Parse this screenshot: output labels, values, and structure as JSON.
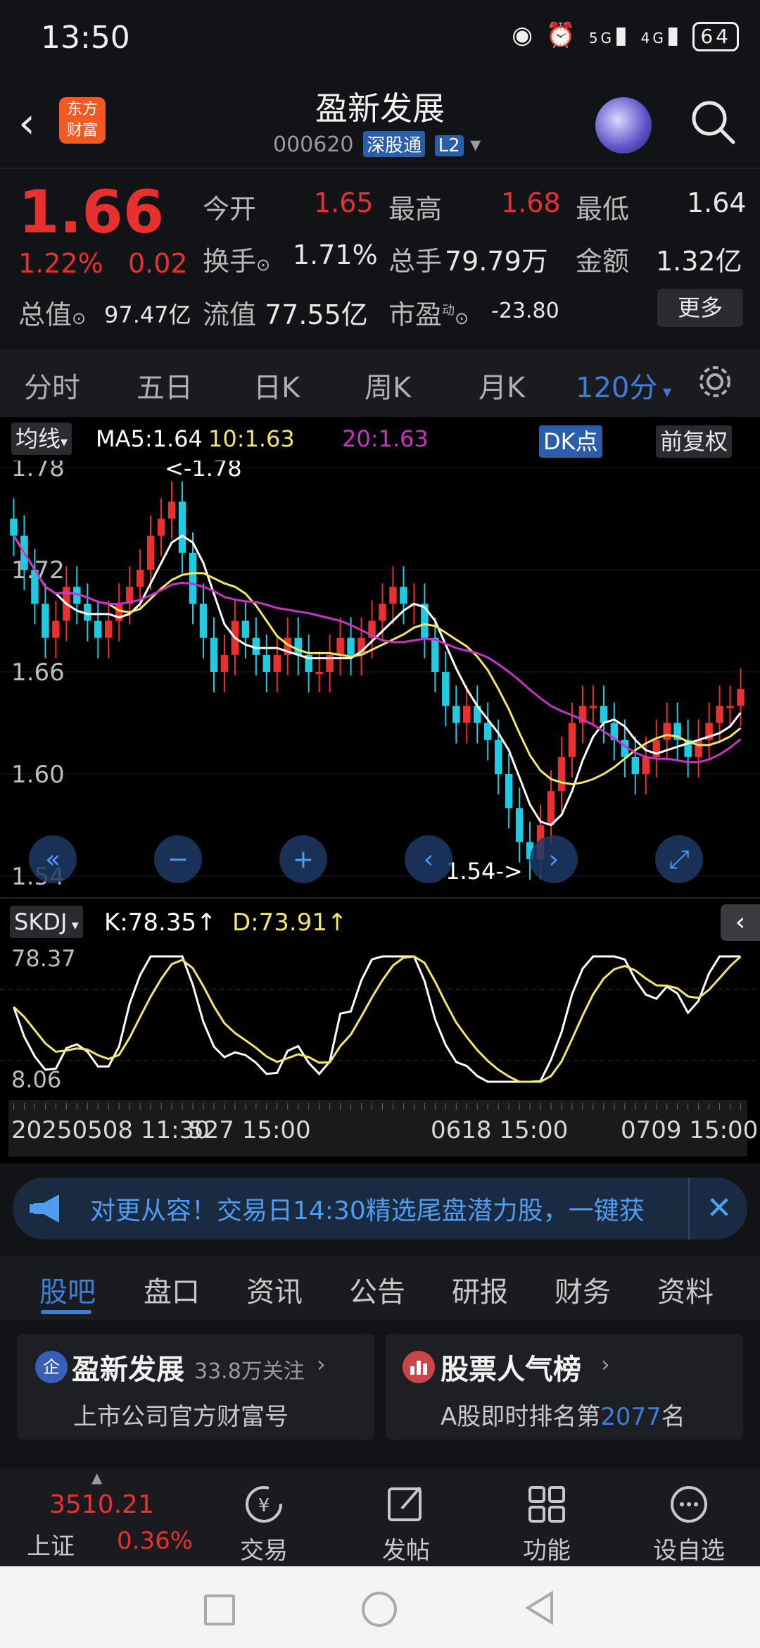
{
  "status_bar": {
    "time": "13:50",
    "network1": "5G",
    "network2": "4G",
    "battery": "64"
  },
  "header": {
    "logo_line1": "东方",
    "logo_line2": "财富",
    "stock_name": "盈新发展",
    "code": "000620",
    "connect_tag": "深股通",
    "level_tag": "L2"
  },
  "quote": {
    "price": "1.66",
    "change_pct": "1.22%",
    "change": "0.02",
    "open_label": "今开",
    "open": "1.65",
    "high_label": "最高",
    "high": "1.68",
    "low_label": "最低",
    "low": "1.64",
    "turnover_label": "换手",
    "turnover": "1.71%",
    "volume_label": "总手",
    "volume": "79.79万",
    "amount_label": "金额",
    "amount": "1.32亿",
    "mcap_label": "总值",
    "mcap": "97.47亿",
    "float_label": "流值",
    "float_cap": "77.55亿",
    "pe_label": "市盈",
    "pe_sup": "动",
    "pe": "-23.80",
    "more": "更多"
  },
  "periods": [
    "分时",
    "五日",
    "日K",
    "周K",
    "月K",
    "120分"
  ],
  "active_period": 5,
  "chart_toolbar": {
    "ma_button": "均线",
    "ma5": "MA5:1.64",
    "ma10": "10:1.63",
    "ma20": "20:1.63",
    "dk_button": "DK点",
    "adjust_button": "前复权"
  },
  "kdj_toolbar": {
    "indicator": "SKDJ",
    "k": "K:78.35",
    "d": "D:73.91"
  },
  "colors": {
    "up": "#e83030",
    "down": "#1ecbe1",
    "ma5": "#ffffff",
    "ma10": "#f5e663",
    "ma20": "#c832c8",
    "accent": "#3d7ed8"
  },
  "chart_data": {
    "type": "candlestick",
    "price_axis": {
      "ticks": [
        "1.78",
        "1.72",
        "1.66",
        "1.60",
        "1.54"
      ],
      "ylim": [
        1.54,
        1.78
      ]
    },
    "annotations": {
      "high": "<-1.78",
      "low": "1.54->"
    },
    "x_ticks": [
      "20250508 11:30",
      "527 15:00",
      "0618 15:00",
      "0709 15:00"
    ],
    "closes": [
      1.74,
      1.72,
      1.7,
      1.68,
      1.69,
      1.71,
      1.7,
      1.69,
      1.68,
      1.69,
      1.7,
      1.71,
      1.72,
      1.74,
      1.75,
      1.76,
      1.73,
      1.7,
      1.68,
      1.66,
      1.67,
      1.69,
      1.68,
      1.67,
      1.66,
      1.67,
      1.68,
      1.67,
      1.66,
      1.66,
      1.67,
      1.68,
      1.67,
      1.68,
      1.69,
      1.7,
      1.71,
      1.7,
      1.7,
      1.68,
      1.66,
      1.64,
      1.63,
      1.64,
      1.63,
      1.62,
      1.6,
      1.58,
      1.56,
      1.55,
      1.57,
      1.59,
      1.61,
      1.63,
      1.64,
      1.64,
      1.63,
      1.62,
      1.61,
      1.6,
      1.61,
      1.62,
      1.63,
      1.62,
      1.61,
      1.62,
      1.63,
      1.64,
      1.64,
      1.65
    ],
    "kdj": {
      "ticks": [
        "78.37",
        "8.06"
      ],
      "k_last": "78.35",
      "d_last": "73.91"
    }
  },
  "chart_controls": [
    "fast-back",
    "zoom-out",
    "zoom-in",
    "prev",
    "next",
    "fullscreen"
  ],
  "banner": {
    "text": "对更从容！交易日14:30精选尾盘潜力股，一键获"
  },
  "section_tabs": [
    "股吧",
    "盘口",
    "资讯",
    "公告",
    "研报",
    "财务",
    "资料"
  ],
  "cards": {
    "company": {
      "title": "盈新发展",
      "followers": "33.8万关注",
      "subtitle": "上市公司官方财富号"
    },
    "rank": {
      "title": "股票人气榜",
      "subtitle_prefix": "A股即时排名第",
      "rank": "2077",
      "subtitle_suffix": "名"
    }
  },
  "bottom_nav": {
    "index_value": "3510.21",
    "index_name": "上证",
    "index_pct": "0.36%",
    "trade": "交易",
    "post": "发帖",
    "functions": "功能",
    "watchlist": "设自选"
  }
}
